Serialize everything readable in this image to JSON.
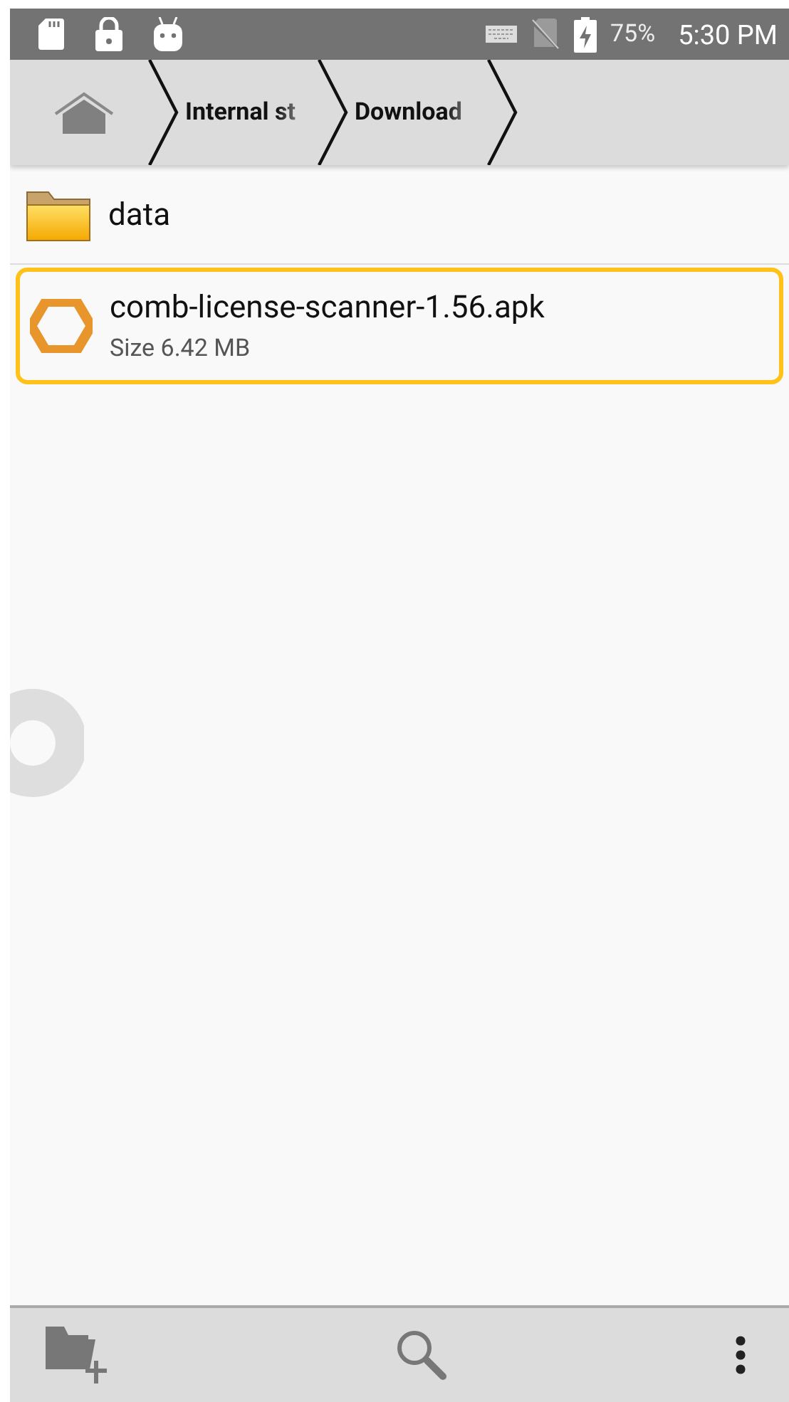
{
  "status_bar": {
    "battery": "75%",
    "time": "5:30 PM"
  },
  "breadcrumbs": [
    {
      "label": "Internal st"
    },
    {
      "label": "Download"
    }
  ],
  "files": [
    {
      "kind": "folder",
      "name": "data",
      "selected": false
    },
    {
      "kind": "apk",
      "name": "comb-license-scanner-1.56.apk",
      "detail": "Size 6.42 MB",
      "selected": true
    }
  ]
}
